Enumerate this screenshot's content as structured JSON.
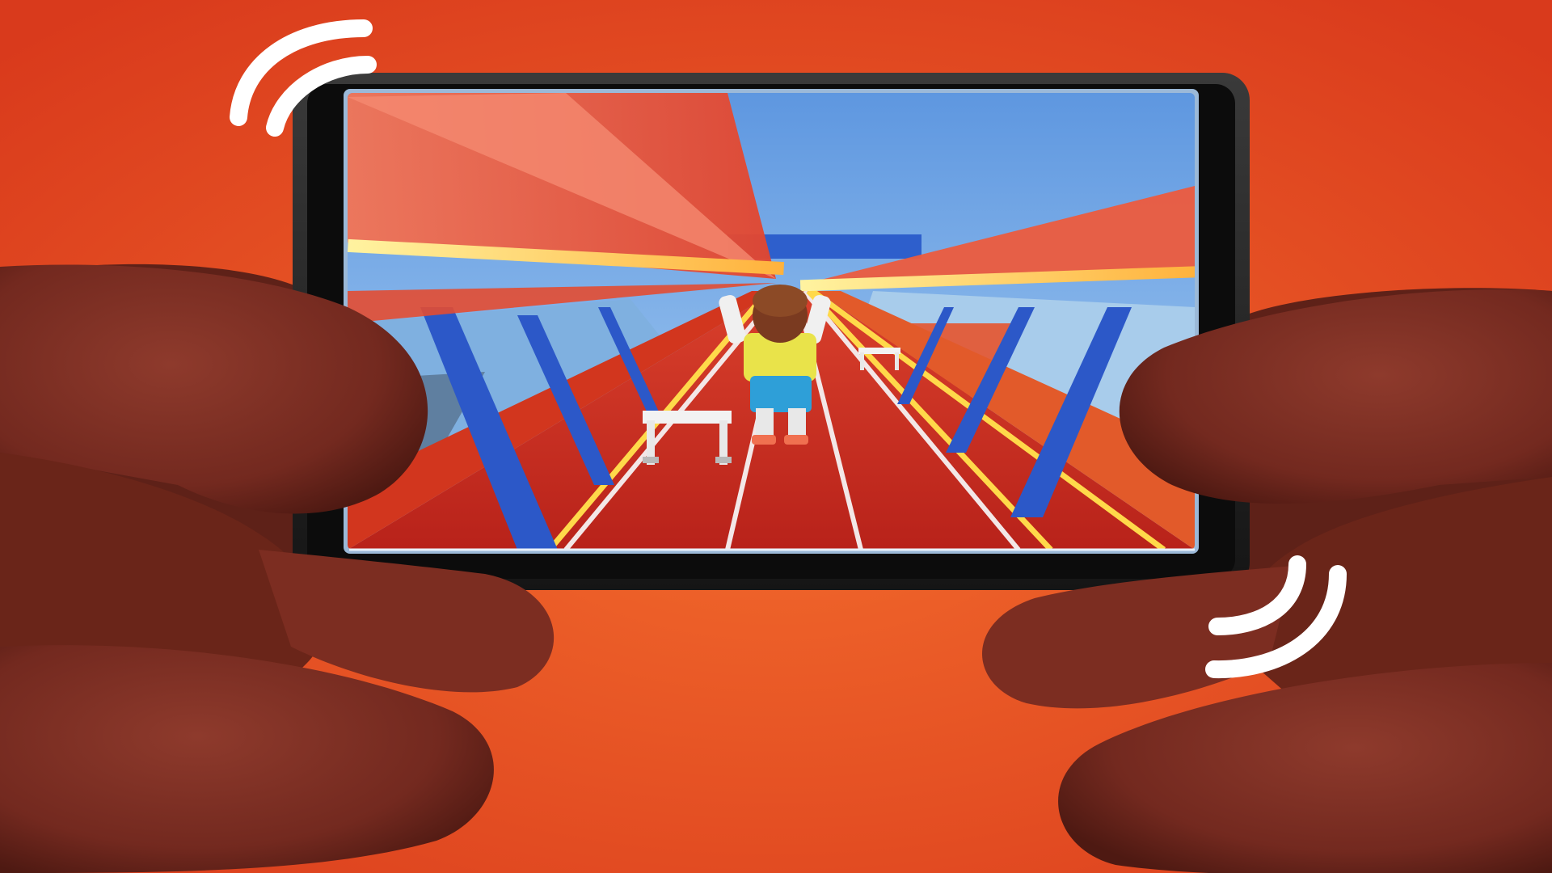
{
  "scene": {
    "background_color": "#E4471F",
    "background_glow": "#F0622A",
    "skin_color": "#7A2E22",
    "skin_shadow": "#4E1912",
    "phone_body": "#1E1E1E",
    "phone_bezel": "#2C2C2C",
    "vibration_mark_color": "#FFFFFF"
  },
  "game": {
    "sky_color": "#6FA6E6",
    "track_color": "#C52A1C",
    "lane_line_color": "#F3E7E7",
    "speed_glow_color": "#FFE36A",
    "speed_beam_color": "#F0563A",
    "railing_color": "#2C58C8",
    "avatar_shirt": "#E9E34A",
    "avatar_shorts": "#2E9FD8"
  },
  "icons": {
    "vibration_top_left": "vibration-waves-icon",
    "vibration_bottom_right": "vibration-waves-icon"
  }
}
